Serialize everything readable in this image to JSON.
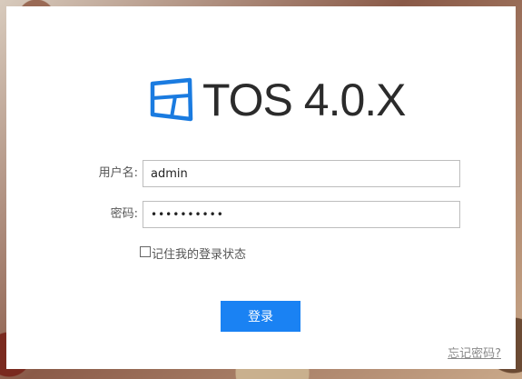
{
  "brand": {
    "product_name": "TOS 4.0.X",
    "icon": "tos-window-logo-icon",
    "logo_color": "#1a7be0"
  },
  "form": {
    "username_label": "用户名:",
    "username_value": "admin",
    "password_label": "密码:",
    "password_value": "••••••••••",
    "remember_label": "记住我的登录状态",
    "remember_checked": false,
    "login_button_label": "登录",
    "forgot_password_link": "忘记密码?"
  },
  "colors": {
    "button_bg": "#1a82f3",
    "panel_bg": "#ffffff"
  }
}
